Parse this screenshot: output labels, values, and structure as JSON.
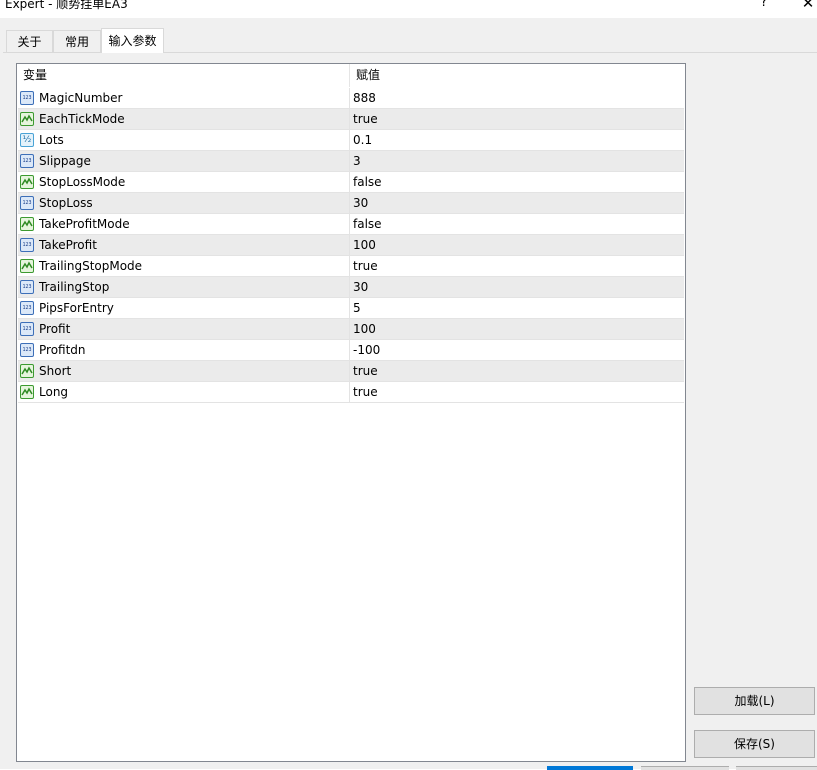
{
  "window": {
    "title": "Expert - 顺势挂单EA3",
    "help_label": "?",
    "close_label": "✕"
  },
  "tabs": [
    {
      "label": "关于",
      "active": false
    },
    {
      "label": "常用",
      "active": false
    },
    {
      "label": "输入参数",
      "active": true
    }
  ],
  "grid": {
    "columns": [
      "变量",
      "赋值"
    ],
    "rows": [
      {
        "name": "MagicNumber",
        "value": "888",
        "icon": "int-icon"
      },
      {
        "name": "EachTickMode",
        "value": "true",
        "icon": "bool-icon"
      },
      {
        "name": "Lots",
        "value": "0.1",
        "icon": "double-icon"
      },
      {
        "name": "Slippage",
        "value": "3",
        "icon": "int-icon"
      },
      {
        "name": "StopLossMode",
        "value": "false",
        "icon": "bool-icon"
      },
      {
        "name": "StopLoss",
        "value": "30",
        "icon": "int-icon"
      },
      {
        "name": "TakeProfitMode",
        "value": "false",
        "icon": "bool-icon"
      },
      {
        "name": "TakeProfit",
        "value": "100",
        "icon": "int-icon"
      },
      {
        "name": "TrailingStopMode",
        "value": "true",
        "icon": "bool-icon"
      },
      {
        "name": "TrailingStop",
        "value": "30",
        "icon": "int-icon"
      },
      {
        "name": "PipsForEntry",
        "value": "5",
        "icon": "int-icon"
      },
      {
        "name": "Profit",
        "value": "100",
        "icon": "int-icon"
      },
      {
        "name": "Profitdn",
        "value": "-100",
        "icon": "int-icon"
      },
      {
        "name": "Short",
        "value": "true",
        "icon": "bool-icon"
      },
      {
        "name": "Long",
        "value": "true",
        "icon": "bool-icon"
      }
    ]
  },
  "buttons": {
    "load_label": "加载(L)",
    "save_label": "保存(S)"
  },
  "colors": {
    "accent": "#0078d7",
    "int_icon": "#3d6fb8",
    "bool_icon": "#3c9a30",
    "double_icon": "#4aa3d6"
  }
}
